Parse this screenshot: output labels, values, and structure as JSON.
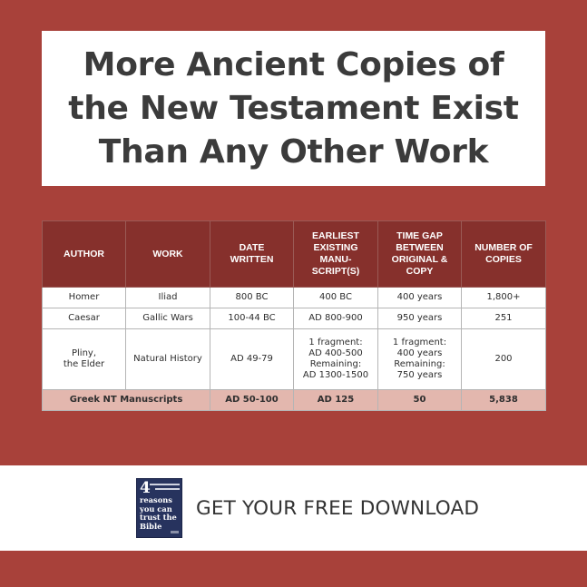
{
  "title": {
    "lines": [
      "More Ancient Copies of",
      "the New Testament Exist",
      "Than Any Other Work"
    ]
  },
  "colors": {
    "background": "#a8413a",
    "header": "#86302c",
    "highlight_row": "#e3b7ae",
    "book_cover": "#27335e"
  },
  "table": {
    "headers": [
      [
        "AUTHOR"
      ],
      [
        "WORK"
      ],
      [
        "DATE",
        "WRITTEN"
      ],
      [
        "EARLIEST",
        "EXISTING",
        "MANU-",
        "SCRIPT(S)"
      ],
      [
        "TIME GAP",
        "BETWEEN",
        "ORIGINAL &",
        "COPY"
      ],
      [
        "NUMBER OF",
        "COPIES"
      ]
    ],
    "rows": [
      {
        "author": [
          "Homer"
        ],
        "work": "Iliad",
        "date_written": "800 BC",
        "earliest": [
          "400 BC"
        ],
        "time_gap": [
          "400 years"
        ],
        "copies": "1,800+"
      },
      {
        "author": [
          "Caesar"
        ],
        "work": "Gallic Wars",
        "date_written": "100-44 BC",
        "earliest": [
          "AD 800-900"
        ],
        "time_gap": [
          "950 years"
        ],
        "copies": "251"
      },
      {
        "author": [
          "Pliny,",
          "the Elder"
        ],
        "work": "Natural History",
        "date_written": "AD 49-79",
        "earliest": [
          "1 fragment:",
          "AD 400-500",
          "Remaining:",
          "AD 1300-1500"
        ],
        "time_gap": [
          "1 fragment:",
          "400 years",
          "Remaining:",
          "750 years"
        ],
        "copies": "200"
      }
    ],
    "total_row": {
      "label": "Greek NT Manuscripts",
      "date_written": "AD 50-100",
      "earliest": "AD 125",
      "time_gap": "50",
      "copies": "5,838"
    }
  },
  "cta": {
    "label": "GET YOUR FREE DOWNLOAD",
    "book": {
      "number": "4",
      "title_lines": [
        "reasons",
        "you can",
        "trust the",
        "Bible"
      ]
    }
  }
}
